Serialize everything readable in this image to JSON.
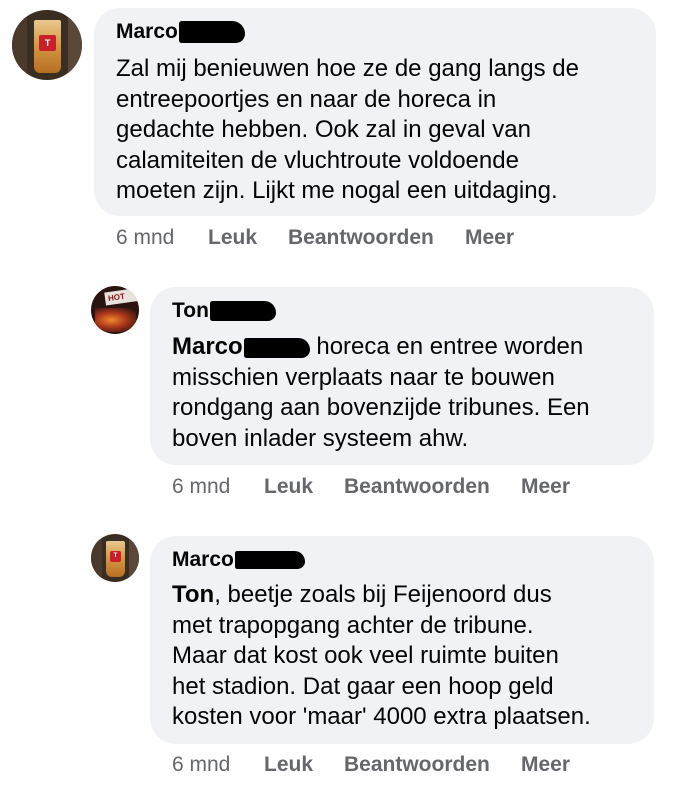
{
  "comments": [
    {
      "author": "Marco",
      "lines": [
        "Zal mij benieuwen hoe ze de gang langs de",
        "entreepoortjes en naar de horeca in",
        "gedachte hebben. Ook zal in geval van",
        "calamiteiten de vluchtroute voldoende",
        "moeten zijn. Lijkt me nogal een uitdaging."
      ],
      "time": "6 mnd",
      "like": "Leuk",
      "reply": "Beantwoorden",
      "more": "Meer"
    },
    {
      "author": "Ton",
      "mention": "Marco",
      "first_line_rest": "horeca en entree worden",
      "lines": [
        "misschien verplaats naar te bouwen",
        "rondgang aan bovenzijde tribunes. Een",
        "boven inlader systeem ahw."
      ],
      "time": "6 mnd",
      "like": "Leuk",
      "reply": "Beantwoorden",
      "more": "Meer"
    },
    {
      "author": "Marco",
      "mention": "Ton",
      "first_line_rest": ", beetje zoals bij Feijenoord dus",
      "lines": [
        "met trapopgang achter de tribune.",
        "Maar dat kost ook veel ruimte buiten",
        "het stadion. Dat gaar een hoop geld",
        "kosten voor 'maar' 4000 extra plaatsen."
      ],
      "time": "6 mnd",
      "like": "Leuk",
      "reply": "Beantwoorden",
      "more": "Meer"
    }
  ],
  "avatar_logo": "T",
  "avatar_sign": "HOT"
}
